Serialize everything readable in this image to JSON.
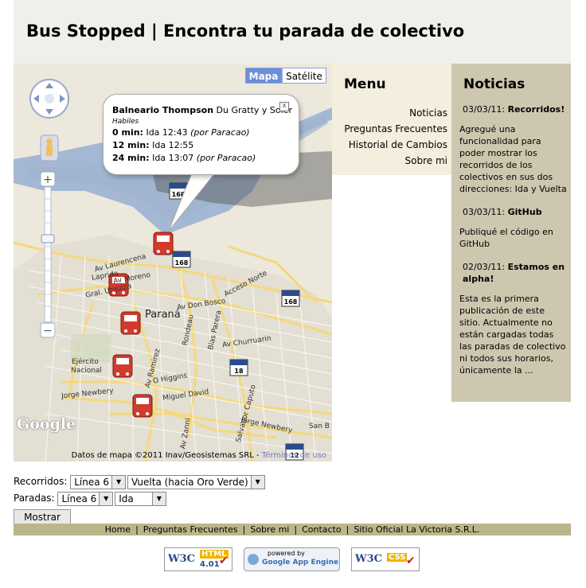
{
  "header": {
    "title": "Bus Stopped | Encontra tu parada de colectivo"
  },
  "map": {
    "type_buttons": {
      "map": "Mapa",
      "satellite": "Satélite"
    },
    "info_window": {
      "stop_name": "Balneario Thompson",
      "stop_address": "Du Gratty y Soler",
      "day_type": "Habiles",
      "arrivals": [
        {
          "eta": "0 min:",
          "trip": "Ida 12:43",
          "note": "(por Paracao)"
        },
        {
          "eta": "12 min:",
          "trip": "Ida 12:55",
          "note": ""
        },
        {
          "eta": "24 min:",
          "trip": "Ida 13:07",
          "note": "(por Paracao)"
        }
      ],
      "close_symbol": "x"
    },
    "labels": {
      "city": "Paraná",
      "ejercito": "Ejército",
      "nacional": "Nacional",
      "san_b": "San B",
      "streets": [
        "Av Laurencena",
        "Av Moreno",
        "Av Don Bosco",
        "Acceso Norte",
        "Av Churruarin",
        "O Higgins",
        "Miguel David",
        "Jorge Newbery",
        "Jorge Newbery",
        "Av Ramirez",
        "Av Zanni",
        "Salvador Caputo",
        "Blas Parera",
        "Rondeau",
        "Gral. Urquiza",
        "Laprida"
      ],
      "routes": [
        "168",
        "168",
        "168",
        "18",
        "12"
      ],
      "route_prefix": "RA"
    },
    "copyright": "Datos de mapa ©2011 Inav/Geosistemas SRL -",
    "terms": "Términos de uso",
    "google_logo": "Google",
    "icons": [
      "pan-control-icon",
      "street-view-pegman-icon",
      "zoom-in-icon",
      "zoom-out-icon",
      "bus-stop-marker-icon"
    ]
  },
  "menu": {
    "title": "Menu",
    "items": [
      "Noticias",
      "Preguntas Frecuentes",
      "Historial de Cambios",
      "Sobre mi"
    ]
  },
  "news": {
    "title": "Noticias",
    "items": [
      {
        "date": "03/03/11:",
        "headline": "Recorridos!",
        "body": "Agregué una funcionalidad para poder mostrar los recorridos de los colectivos en sus dos direcciones: Ida y Vuelta"
      },
      {
        "date": "03/03/11:",
        "headline": "GitHub",
        "body": "Publiqué el código en GitHub"
      },
      {
        "date": "02/03/11:",
        "headline": "Estamos en alpha!",
        "body": "Esta es la primera publicación de este sitio. Actualmente no están cargadas todas las paradas de colectivo ni todos sus horarios, únicamente la ..."
      }
    ]
  },
  "controls": {
    "recorridos_label": "Recorridos:",
    "recorridos_line": "Línea 6",
    "recorridos_direction": "Vuelta (hacia Oro Verde)",
    "paradas_label": "Paradas:",
    "paradas_line": "Línea 6",
    "paradas_direction": "Ida",
    "show_button": "Mostrar"
  },
  "footer": {
    "links": [
      "Home",
      "Preguntas Frecuentes",
      "Sobre mi",
      "Contacto",
      "Sitio Oficial La Victoria S.R.L."
    ],
    "separator": "|"
  },
  "badges": {
    "w3c_html": {
      "w3c": "W3C",
      "label": "HTML",
      "version": "4.01"
    },
    "app_engine": {
      "powered": "powered by",
      "label": "Google App Engine"
    },
    "w3c_css": {
      "w3c": "W3C",
      "label": "CSS"
    }
  },
  "colors": {
    "header_bg": "#f0efea",
    "menu_bg": "#f3eede",
    "news_bg": "#cdc7b0",
    "footer_bg": "#bbb58a",
    "map_type_active": "#6b8ed6",
    "river": "#a4b8d4",
    "bus_marker": "#d33a2c"
  }
}
